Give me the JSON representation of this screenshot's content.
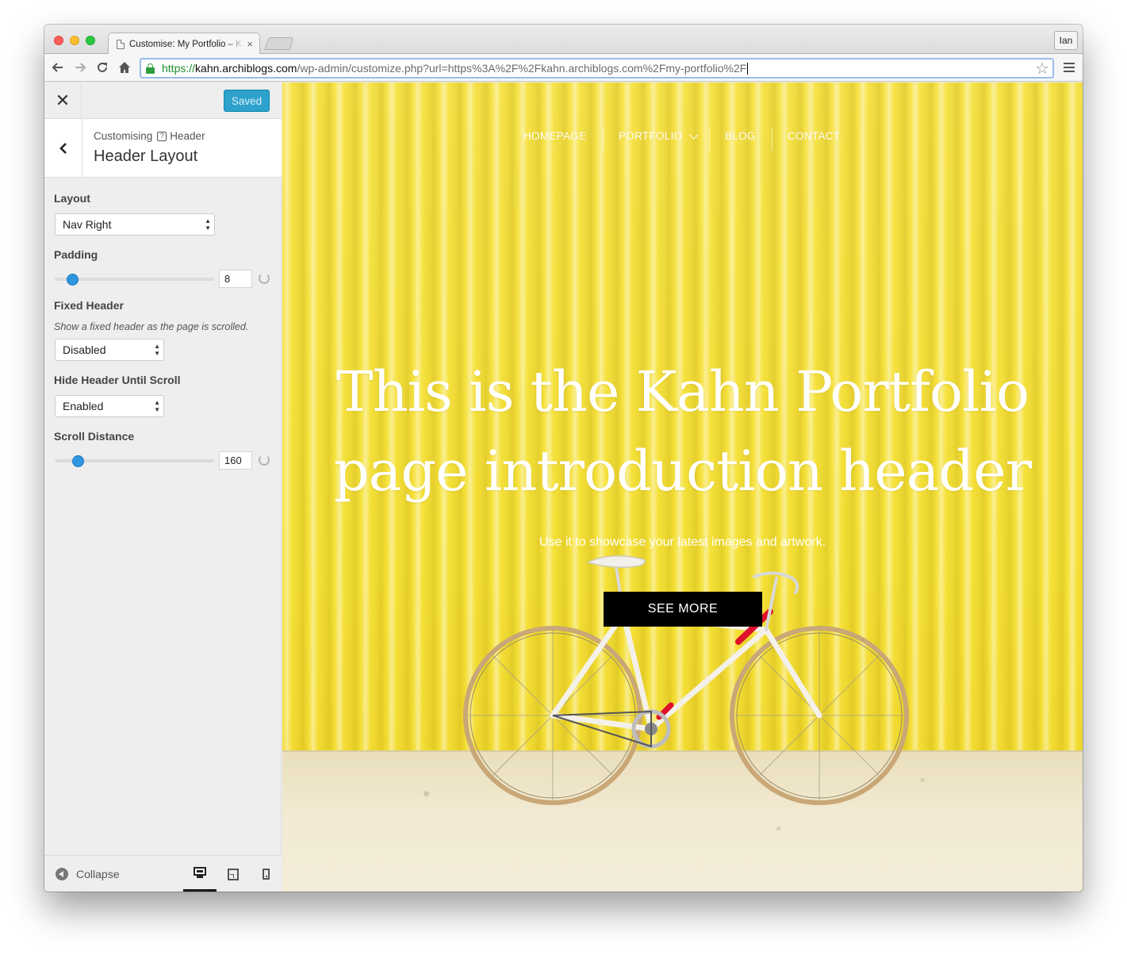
{
  "browser": {
    "tab_title": "Customise: My Portfolio – Kahn",
    "tab_close": "×",
    "profile": "Ian",
    "url_scheme": "https://",
    "url_host": "kahn.archiblogs.com",
    "url_path": "/wp-admin/customize.php?url=https%3A%2F%2Fkahn.archiblogs.com%2Fmy-portfolio%2F",
    "icons": [
      "back-arrow-icon",
      "forward-arrow-icon",
      "reload-icon",
      "home-icon",
      "lock-icon",
      "star-icon",
      "menu-icon"
    ]
  },
  "customizer": {
    "close_glyph": "✕",
    "saved_label": "Saved",
    "back_glyph": "‹",
    "breadcrumb_prefix": "Customising",
    "breadcrumb_help": "?",
    "breadcrumb_section": "Header",
    "section_title": "Header Layout",
    "controls": {
      "layout": {
        "label": "Layout",
        "value": "Nav Right"
      },
      "padding": {
        "label": "Padding",
        "value": "8",
        "level": 0.08
      },
      "fixed_header": {
        "label": "Fixed Header",
        "description": "Show a fixed header as the page is scrolled.",
        "value": "Disabled"
      },
      "hide_header": {
        "label": "Hide Header Until Scroll",
        "value": "Enabled"
      },
      "scroll_distance": {
        "label": "Scroll Distance",
        "value": "160",
        "level": 0.12
      }
    },
    "footer": {
      "collapse_label": "Collapse",
      "devices": [
        "desktop",
        "tablet",
        "mobile"
      ],
      "active_device": "desktop"
    },
    "colors": {
      "primary": "#2ea2cc",
      "slider": "#2f95de"
    }
  },
  "preview": {
    "nav": [
      "HOMEPAGE",
      "PORTFOLIO",
      "BLOG",
      "CONTACT"
    ],
    "hero_line1": "This is the Kahn Portfolio",
    "hero_line2": "page introduction header",
    "subtitle": "Use it to showcase your latest images and artwork.",
    "cta": "SEE MORE",
    "background_color": "#f5e136"
  }
}
